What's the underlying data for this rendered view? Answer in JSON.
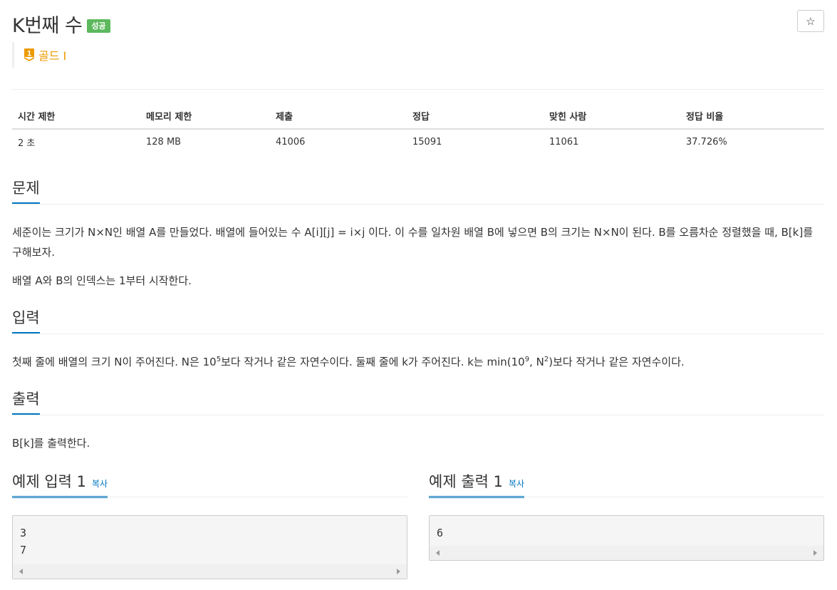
{
  "problem": {
    "title": "K번째 수",
    "result_badge": "성공",
    "star_icon": "☆",
    "tier_icon": "gold-1-tier-icon",
    "tier_num": "1",
    "tier_label": "골드 I"
  },
  "info_table": {
    "headers": [
      "시간 제한",
      "메모리 제한",
      "제출",
      "정답",
      "맞힌 사람",
      "정답 비율"
    ],
    "values": [
      "2 초",
      "128 MB",
      "41006",
      "15091",
      "11061",
      "37.726%"
    ]
  },
  "sections": {
    "description": {
      "title": "문제",
      "p1": "세준이는 크기가 N×N인 배열 A를 만들었다. 배열에 들어있는 수 A[i][j] = i×j 이다. 이 수를 일차원 배열 B에 넣으면 B의 크기는 N×N이 된다. B를 오름차순 정렬했을 때, B[k]를 구해보자.",
      "p2": "배열 A와 B의 인덱스는 1부터 시작한다."
    },
    "input": {
      "title": "입력",
      "t1": "첫째 줄에 배열의 크기 N이 주어진다. N은 10",
      "s1": "5",
      "t2": "보다 작거나 같은 자연수이다. 둘째 줄에 k가 주어진다. k는 min(10",
      "s2": "9",
      "t3": ", N",
      "s3": "2",
      "t4": ")보다 작거나 같은 자연수이다."
    },
    "output": {
      "title": "출력",
      "p1": "B[k]를 출력한다."
    }
  },
  "samples": {
    "input": {
      "title": "예제 입력 1",
      "copy_label": "복사",
      "content": "3\n7"
    },
    "output": {
      "title": "예제 출력 1",
      "copy_label": "복사",
      "content": "6"
    }
  },
  "colors": {
    "accent": "#0076c0",
    "success": "#5cb85c",
    "gold": "#ec9a00"
  }
}
